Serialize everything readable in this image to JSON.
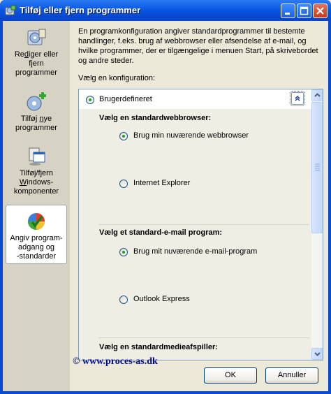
{
  "window": {
    "title": "Tilføj eller fjern programmer"
  },
  "sidebar": {
    "items": [
      {
        "line1": "Re",
        "ul": "d",
        "rest": "iger eller",
        "line2": "fjern",
        "line3": "programmer",
        "icon": "edit-remove-programs-icon"
      },
      {
        "line1": "Tilføj ",
        "ul": "n",
        "rest": "ye",
        "line2": "programmer",
        "icon": "add-programs-icon"
      },
      {
        "line1": "Tilføj/fjern",
        "pre": "",
        "ul": "W",
        "rest": "indows-",
        "line3": "komponenter",
        "icon": "windows-components-icon"
      },
      {
        "line1": "Angiv program-",
        "line2": "adgang og",
        "line3": "-standarder",
        "icon": "program-access-icon"
      }
    ]
  },
  "main": {
    "intro": "En programkonfiguration angiver standardprogrammer til bestemte handlinger, f.eks. brug af webbrowser eller afsendelse af e-mail, og hvilke programmer, der er tilgængelige i menuen Start, på skrivebordet og andre steder.",
    "choose_label": "Vælg en konfiguration:",
    "config_name": "Brugerdefineret",
    "groups": [
      {
        "title": "Vælg en standardwebbrowser:",
        "options": [
          "Brug min nuværende webbrowser",
          "Internet Explorer"
        ]
      },
      {
        "title": "Vælg et standard-e-mail program:",
        "options": [
          "Brug mit nuværende e-mail-program",
          "Outlook Express"
        ]
      },
      {
        "title": "Vælg en standardmedieafspiller:"
      }
    ]
  },
  "footer": {
    "watermark": "© www.proces-as.dk",
    "ok_label": "OK",
    "cancel_label": "Annuller"
  }
}
